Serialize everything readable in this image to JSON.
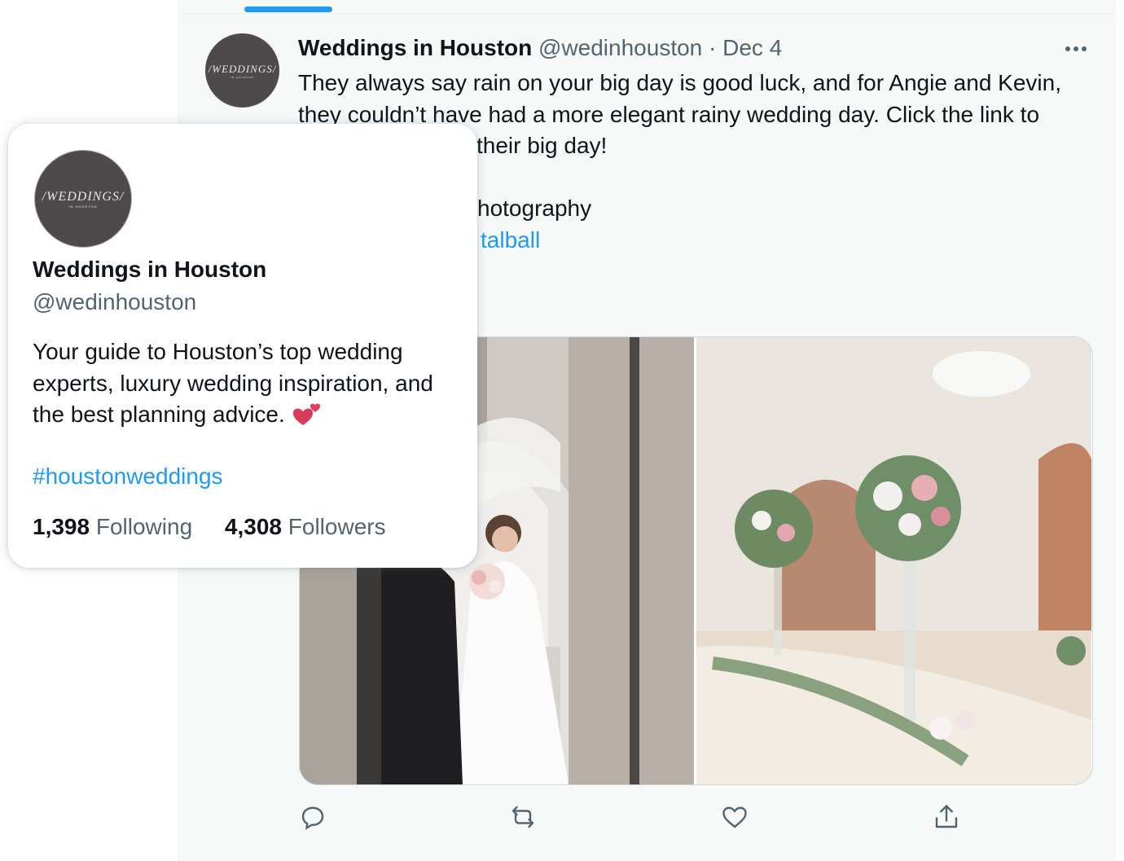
{
  "tweet": {
    "author_name": "Weddings in Houston",
    "author_handle": "@wedinhouston",
    "separator": "·",
    "date": "Dec 4",
    "text_lines": [
      "They always say rain on your big day is good luck, and for Angie and Kevin,",
      "they couldn’t have had a more elegant rainy wedding day. Click the link to",
      "their big day!"
    ],
    "credit_fragment": "hotography",
    "link_fragment": "talball"
  },
  "avatar": {
    "logo_main": "/WEDDINGS/",
    "logo_sub": "IN HOUSTON"
  },
  "actions": [
    "reply-icon",
    "retweet-icon",
    "like-icon",
    "share-icon"
  ],
  "profile_card": {
    "name": "Weddings in Houston",
    "handle": "@wedinhouston",
    "bio_lines": [
      "Your guide to Houston’s top wedding",
      "experts, luxury wedding inspiration, and",
      "the best planning advice."
    ],
    "hashtag": "#houstonweddings",
    "following_count": "1,398",
    "following_label": "Following",
    "followers_count": "4,308",
    "followers_label": "Followers"
  },
  "colors": {
    "accent": "#1d9bf0",
    "text_primary": "#0f1419",
    "text_secondary": "#536471",
    "heart_emoji": "#d93b5c"
  }
}
